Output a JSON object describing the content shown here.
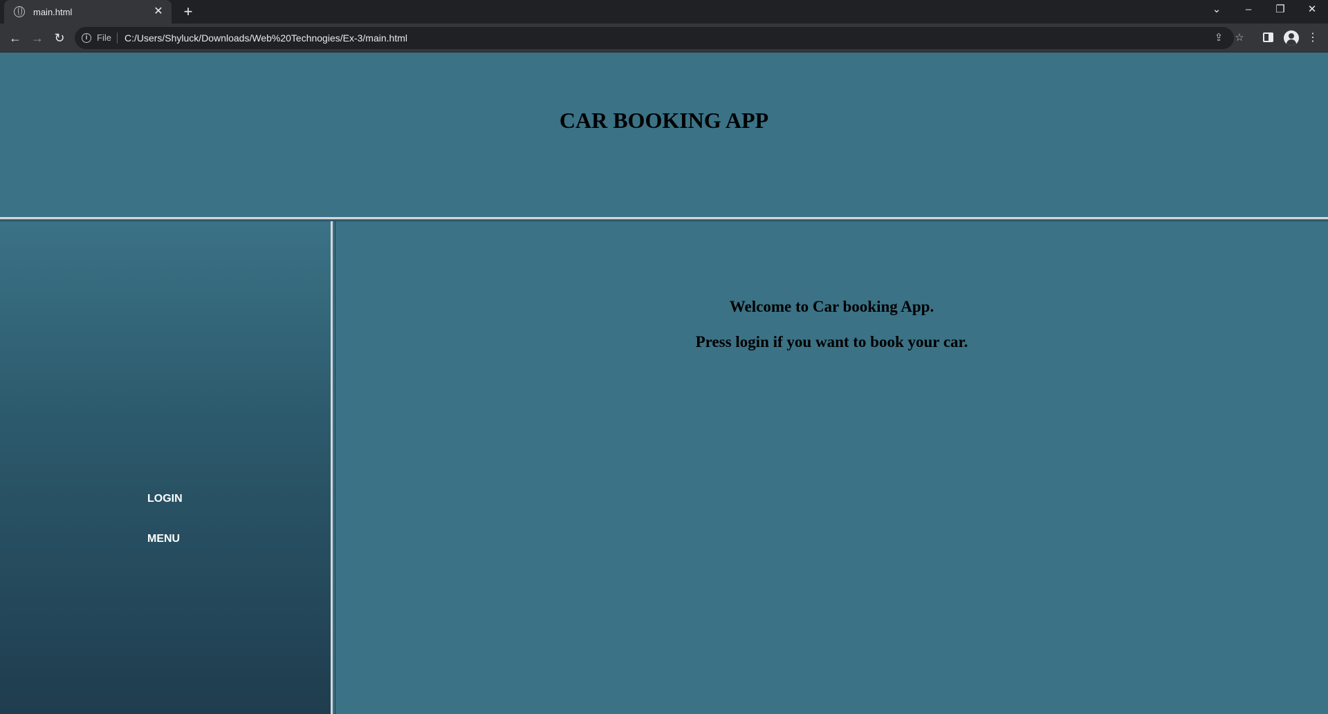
{
  "browser": {
    "tab_title": "main.html",
    "new_tab": "+",
    "file_label": "File",
    "url": "C:/Users/Shyluck/Downloads/Web%20Technogies/Ex-3/main.html"
  },
  "page": {
    "title": "CAR BOOKING APP",
    "sidebar": {
      "login": "LOGIN",
      "menu": "MENU"
    },
    "main": {
      "line1": "Welcome to Car booking App.",
      "line2": "Press login if you want to book your car."
    }
  },
  "colors": {
    "page_bg": "#3b7286",
    "divider": "#d4d7da",
    "sidebar_bottom": "#1f3d4f"
  }
}
